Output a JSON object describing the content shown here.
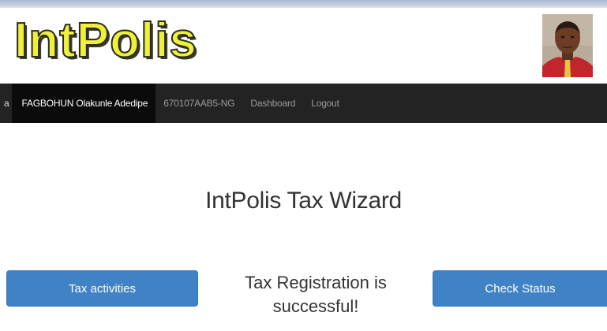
{
  "header": {
    "logo_text": "IntPolis",
    "logo_color": "#eef03a"
  },
  "navbar": {
    "items": [
      {
        "label": "a"
      },
      {
        "label": "FAGBOHUN Olakunle Adedipe"
      },
      {
        "label": "670107AAB5-NG"
      },
      {
        "label": "Dashboard"
      },
      {
        "label": "Logout"
      }
    ],
    "background": "#232323"
  },
  "main": {
    "title": "IntPolis Tax Wizard",
    "left_button_label": "Tax activities",
    "right_button_label": "Check Status",
    "status_message": "Tax Registration is successful!",
    "button_color": "#3f82c6"
  }
}
